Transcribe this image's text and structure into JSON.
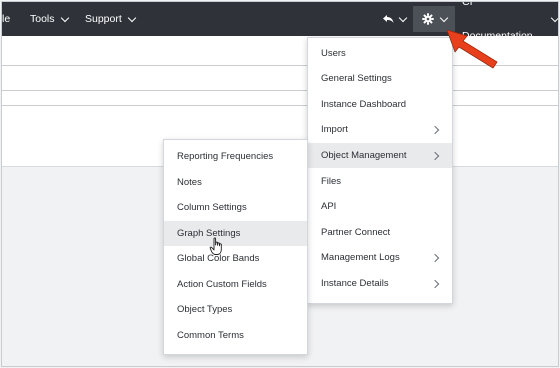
{
  "topbar": {
    "partial_left": "le",
    "tools": "Tools",
    "support": "Support",
    "account": "CI Documentation"
  },
  "settings_menu": {
    "items": [
      {
        "label": "Users",
        "submenu": false
      },
      {
        "label": "General Settings",
        "submenu": false
      },
      {
        "label": "Instance Dashboard",
        "submenu": false
      },
      {
        "label": "Import",
        "submenu": true
      },
      {
        "label": "Object Management",
        "submenu": true
      },
      {
        "label": "Files",
        "submenu": false
      },
      {
        "label": "API",
        "submenu": false
      },
      {
        "label": "Partner Connect",
        "submenu": false
      },
      {
        "label": "Management Logs",
        "submenu": true
      },
      {
        "label": "Instance Details",
        "submenu": true
      }
    ],
    "highlighted": "Object Management"
  },
  "object_management_menu": {
    "items": [
      {
        "label": "Reporting Frequencies"
      },
      {
        "label": "Notes"
      },
      {
        "label": "Column Settings"
      },
      {
        "label": "Graph Settings"
      },
      {
        "label": "Global Color Bands"
      },
      {
        "label": "Action Custom Fields"
      },
      {
        "label": "Object Types"
      },
      {
        "label": "Common Terms"
      }
    ],
    "highlighted": "Graph Settings"
  },
  "colors": {
    "topbar": "#2f3339",
    "accent_arrow": "#e8401c",
    "highlight": "#e9eaec"
  }
}
